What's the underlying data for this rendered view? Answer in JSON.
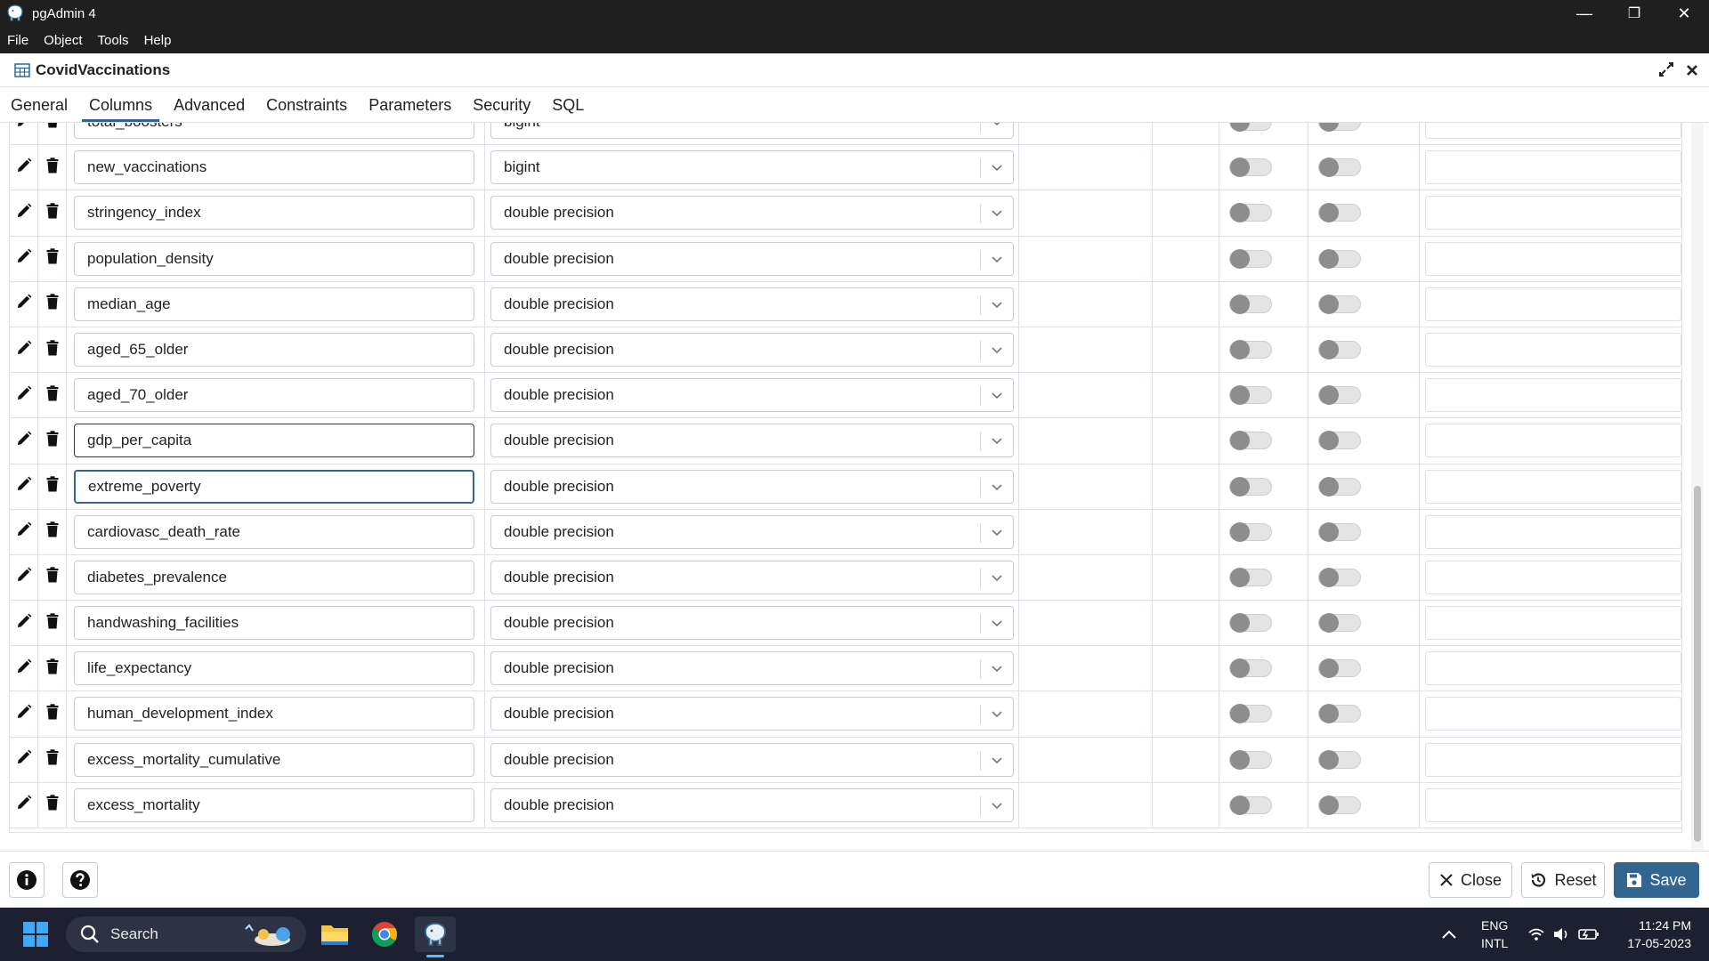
{
  "window": {
    "title": "pgAdmin 4",
    "minimize": "—",
    "maximize": "❐",
    "close": "✕"
  },
  "menu": [
    "File",
    "Object",
    "Tools",
    "Help"
  ],
  "dialog": {
    "title": "CovidVaccinations"
  },
  "tabs": [
    {
      "label": "General",
      "active": false
    },
    {
      "label": "Columns",
      "active": true
    },
    {
      "label": "Advanced",
      "active": false
    },
    {
      "label": "Constraints",
      "active": false
    },
    {
      "label": "Parameters",
      "active": false
    },
    {
      "label": "Security",
      "active": false
    },
    {
      "label": "SQL",
      "active": false
    }
  ],
  "columns": [
    {
      "name": "total_boosters",
      "type": "bigint",
      "state": "partial"
    },
    {
      "name": "new_vaccinations",
      "type": "bigint",
      "state": "normal"
    },
    {
      "name": "stringency_index",
      "type": "double precision",
      "state": "normal"
    },
    {
      "name": "population_density",
      "type": "double precision",
      "state": "normal"
    },
    {
      "name": "median_age",
      "type": "double precision",
      "state": "normal"
    },
    {
      "name": "aged_65_older",
      "type": "double precision",
      "state": "normal"
    },
    {
      "name": "aged_70_older",
      "type": "double precision",
      "state": "normal"
    },
    {
      "name": "gdp_per_capita",
      "type": "double precision",
      "state": "dark"
    },
    {
      "name": "extreme_poverty",
      "type": "double precision",
      "state": "focus"
    },
    {
      "name": "cardiovasc_death_rate",
      "type": "double precision",
      "state": "normal"
    },
    {
      "name": "diabetes_prevalence",
      "type": "double precision",
      "state": "normal"
    },
    {
      "name": "handwashing_facilities",
      "type": "double precision",
      "state": "normal"
    },
    {
      "name": "life_expectancy",
      "type": "double precision",
      "state": "normal"
    },
    {
      "name": "human_development_index",
      "type": "double precision",
      "state": "normal"
    },
    {
      "name": "excess_mortality_cumulative",
      "type": "double precision",
      "state": "normal"
    },
    {
      "name": "excess_mortality",
      "type": "double precision",
      "state": "normal"
    }
  ],
  "footer": {
    "close_label": "Close",
    "reset_label": "Reset",
    "save_label": "Save"
  },
  "taskbar": {
    "search_placeholder": "Search",
    "lang_top": "ENG",
    "lang_bottom": "INTL",
    "time": "11:24 PM",
    "date": "17-05-2023"
  },
  "colors": {
    "accent": "#326690",
    "titlebar": "#1f1f1f",
    "taskbar": "#1c2030"
  }
}
